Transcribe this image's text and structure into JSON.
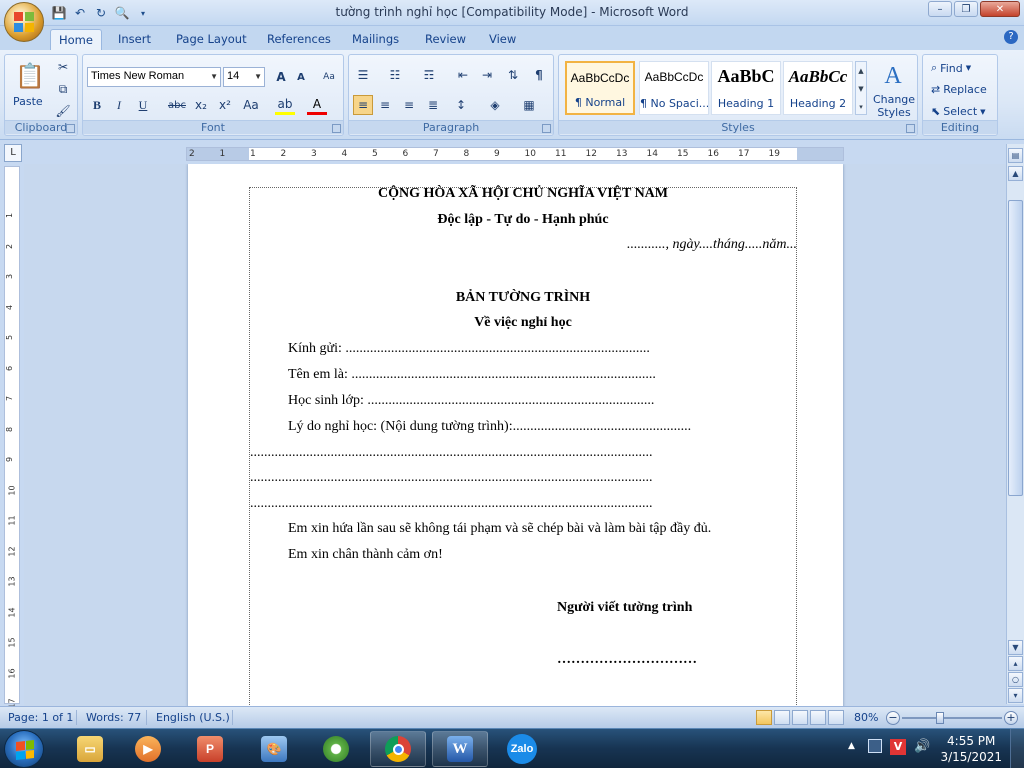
{
  "window": {
    "title": "tường trình nghỉ học [Compatibility Mode] - Microsoft Word",
    "minimize": "–",
    "restore": "❐",
    "close": "✕"
  },
  "tabs": [
    "Home",
    "Insert",
    "Page Layout",
    "References",
    "Mailings",
    "Review",
    "View"
  ],
  "ribbon": {
    "clipboard": {
      "label": "Clipboard",
      "paste": "Paste"
    },
    "font": {
      "label": "Font",
      "font_name": "Times New Roman",
      "font_size": "14",
      "bold": "B",
      "italic": "I",
      "underline": "U",
      "strike": "abc",
      "subscript": "x₂",
      "superscript": "x²",
      "change_case": "Aa",
      "grow": "A",
      "shrink": "A",
      "font_color": "A"
    },
    "paragraph": {
      "label": "Paragraph",
      "pilcrow": "¶"
    },
    "styles": {
      "label": "Styles",
      "items": [
        {
          "sample": "AaBbCcDc",
          "name": "¶ Normal"
        },
        {
          "sample": "AaBbCcDc",
          "name": "¶ No Spaci..."
        },
        {
          "sample": "AaBbC",
          "name": "Heading 1"
        },
        {
          "sample": "AaBbCc",
          "name": "Heading 2"
        }
      ],
      "change_styles": "Change Styles"
    },
    "editing": {
      "label": "Editing",
      "find": "Find",
      "replace": "Replace",
      "select": "Select"
    }
  },
  "ruler": {
    "labels": [
      "2",
      "1",
      "1",
      "2",
      "3",
      "4",
      "5",
      "6",
      "7",
      "8",
      "9",
      "10",
      "11",
      "12",
      "13",
      "14",
      "15",
      "16",
      "17",
      "19"
    ],
    "vlabels": [
      "1",
      "2",
      "3",
      "4",
      "5",
      "6",
      "7",
      "8",
      "9",
      "10",
      "11",
      "12",
      "13",
      "14",
      "15",
      "16",
      "17"
    ]
  },
  "document": {
    "line1": "CỘNG HÒA XÃ HỘI CHỦ NGHĨA VIỆT NAM",
    "line2": "Độc lập - Tự do - Hạnh phúc",
    "date": "..........., ngày....tháng.....năm...",
    "title": "BẢN TƯỜNG TRÌNH",
    "subtitle": "Về việc nghỉ học",
    "kinh_gui": "Kính gửi: .......................................................................................",
    "ten_em": "Tên em là: .......................................................................................",
    "hoc_sinh": "Học sinh lớp: ..................................................................................",
    "ly_do": "Lý do nghỉ học: (Nội dung tường trình):...................................................",
    "dots1": "...................................................................................................................",
    "dots2": "...................................................................................................................",
    "dots3": "...................................................................................................................",
    "promise": "Em xin hứa lần sau sẽ không tái phạm và sẽ chép bài và làm bài tập đầy đủ.",
    "thanks": "Em xin chân thành cảm ơn!",
    "signer": "Người viết tường trình",
    "sign_dots": "…………………………"
  },
  "status": {
    "page": "Page: 1 of 1",
    "words": "Words: 77",
    "language": "English (U.S.)",
    "zoom": "80%"
  },
  "taskbar": {
    "apps": [
      "File Explorer",
      "Media Player",
      "PowerPoint",
      "Paint",
      "CCleaner",
      "Chrome",
      "Word",
      "Zalo"
    ],
    "zalo_label": "Zalo",
    "time": "4:55 PM",
    "date": "3/15/2021"
  },
  "colors": {
    "accent": "#15428b",
    "ribbon_bg": "#dbe7f6",
    "style_selected": "#f2b343"
  }
}
